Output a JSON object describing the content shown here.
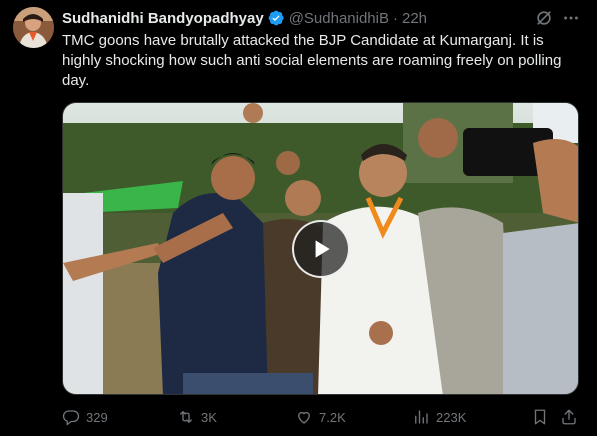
{
  "author": {
    "display_name": "Sudhanidhi Bandyopadhyay",
    "handle": "@SudhanidhiB",
    "separator": "·",
    "time": "22h",
    "verified": true
  },
  "tweet": {
    "text": "TMC goons have brutally attacked the BJP Candidate at Kumarganj. It is highly shocking how such anti social elements are roaming freely on polling day."
  },
  "media": {
    "type": "video"
  },
  "actions": {
    "replies": "329",
    "reposts": "3K",
    "likes": "7.2K",
    "views": "223K"
  },
  "colors": {
    "background": "#000000",
    "text": "#e7e9ea",
    "muted": "#71767b",
    "verified": "#1d9bf0"
  },
  "icons": [
    "verified-badge-icon",
    "grok-icon",
    "more-icon",
    "play-icon",
    "reply-icon",
    "repost-icon",
    "like-icon",
    "views-icon",
    "bookmark-icon",
    "share-icon"
  ]
}
